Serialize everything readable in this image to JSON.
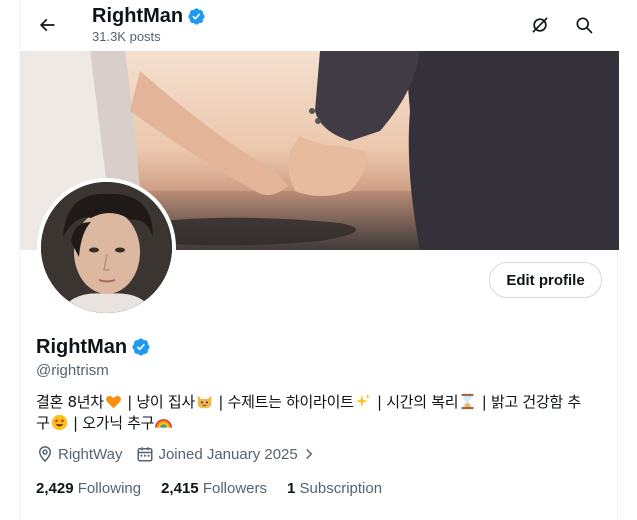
{
  "header": {
    "title": "RightMan",
    "posts_count": "31.3K posts"
  },
  "profile": {
    "name": "RightMan",
    "handle": "@rightrism",
    "edit_label": "Edit profile",
    "bio_line1_a": "결혼 8년차",
    "bio_line1_b": "냥이 집사",
    "bio_line1_c": "수제트는 하이라이트",
    "bio_line1_d": "시간의 복리",
    "bio_line1_e": "밝고 건강함 추",
    "bio_line2_a": "구",
    "bio_line2_b": "오가닉 추구",
    "bio_sep": "|",
    "location": "RightWay",
    "joined": "Joined January 2025"
  },
  "stats": {
    "following_count": "2,429",
    "following_label": "Following",
    "followers_count": "2,415",
    "followers_label": "Followers",
    "subscription_count": "1",
    "subscription_label": "Subscription"
  },
  "icons": {
    "back": "arrow-left-icon",
    "grok": "grok-icon",
    "search": "search-icon",
    "verified": "verified-badge-icon",
    "location": "location-pin-icon",
    "calendar": "calendar-icon"
  },
  "colors": {
    "verified_blue": "#1d9bf0",
    "secondary_text": "#536471",
    "primary_text": "#0f1419"
  }
}
